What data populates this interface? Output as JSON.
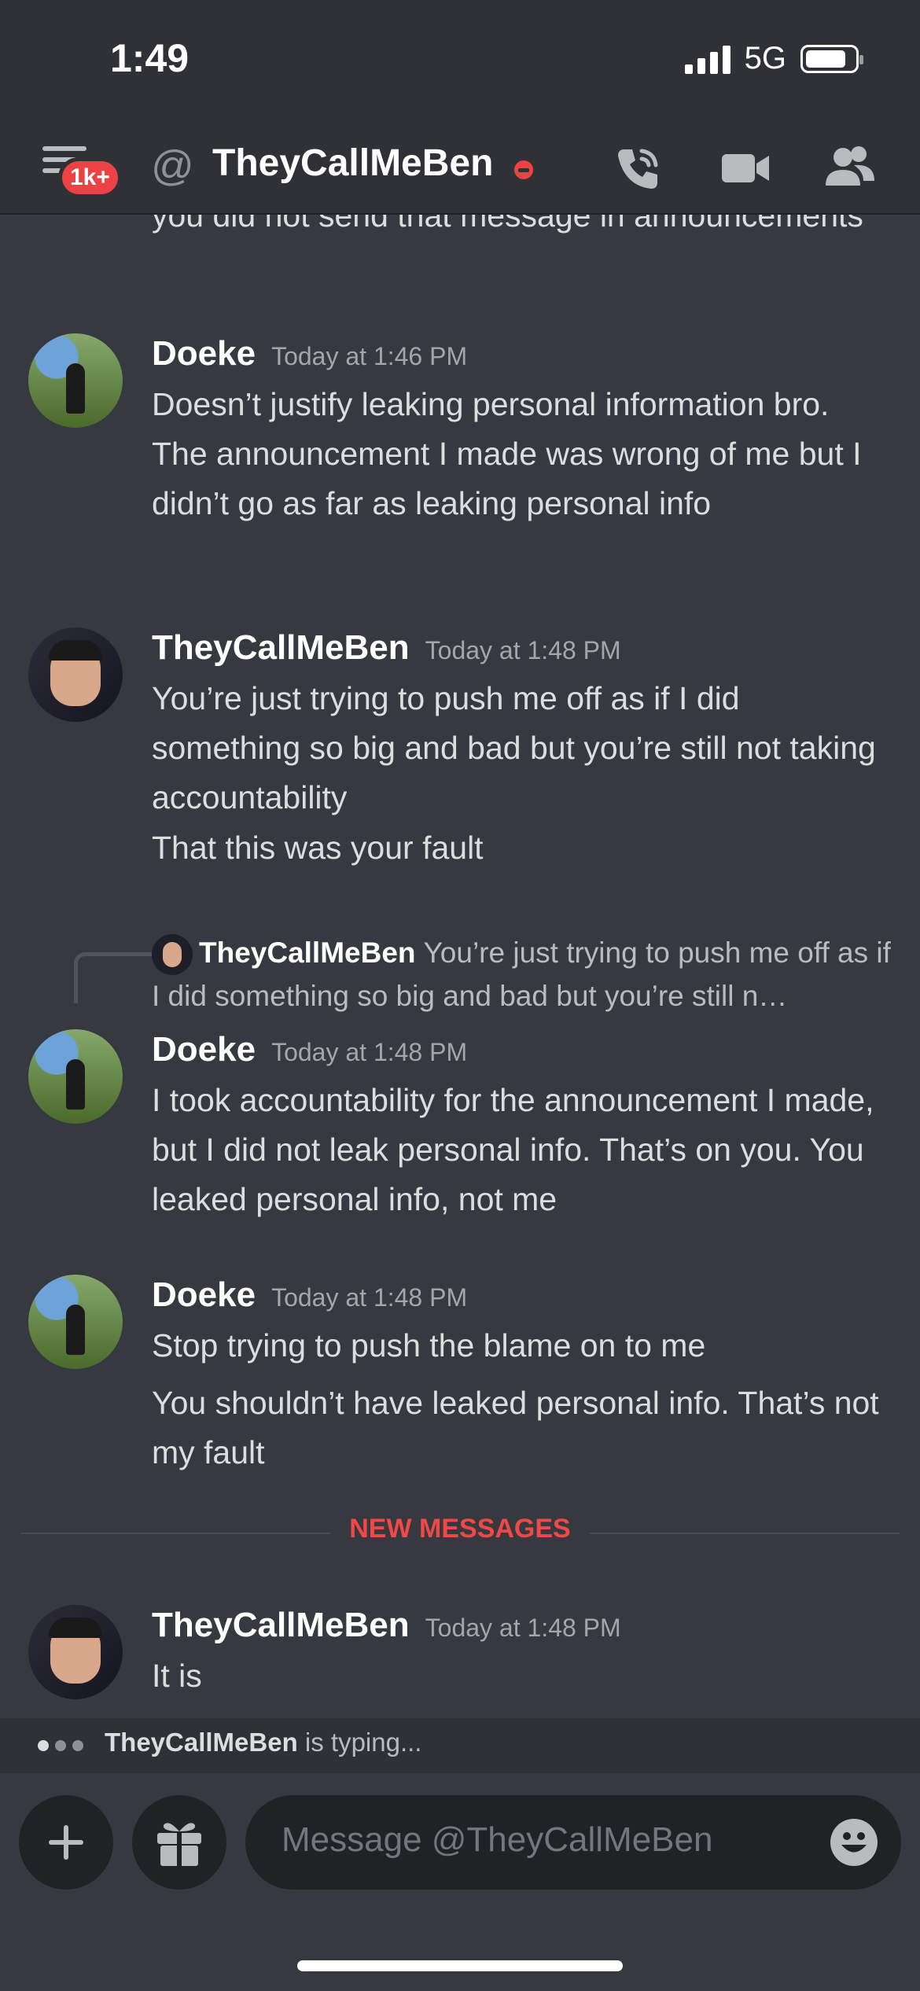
{
  "status_bar": {
    "time": "1:49",
    "network": "5G"
  },
  "header": {
    "notification_badge": "1k+",
    "at_symbol": "@",
    "channel_name": "TheyCallMeBen"
  },
  "chat": {
    "partial_message": {
      "lines": "you did not send that message in announcements"
    },
    "messages": [
      {
        "author": "Doeke",
        "timestamp": "Today at 1:46 PM",
        "text": "Doesn’t justify leaking personal information bro. The announcement I made was wrong of me but I didn’t go as far as leaking personal info"
      },
      {
        "author": "TheyCallMeBen",
        "timestamp": "Today at 1:48 PM",
        "text": "You’re just trying to push me off as if I did something so big and bad but you’re still not taking accountability",
        "followup": "That this was your fault"
      },
      {
        "reply_to": {
          "author": "TheyCallMeBen",
          "text": "You’re just trying to push me off as if I did something so big and bad but you’re still n…"
        },
        "author": "Doeke",
        "timestamp": "Today at 1:48 PM",
        "text": "I took accountability for the announcement I made, but I did not leak personal info. That’s on you. You leaked personal info, not me"
      },
      {
        "author": "Doeke",
        "timestamp": "Today at 1:48 PM",
        "text": "Stop trying to push the blame on to me",
        "followup": "You shouldn’t have leaked personal info. That’s not my fault"
      },
      {
        "author": "TheyCallMeBen",
        "timestamp": "Today at 1:48 PM",
        "text": "It is"
      }
    ],
    "new_messages_label": "NEW MESSAGES"
  },
  "typing": {
    "user": "TheyCallMeBen",
    "suffix": "is typing..."
  },
  "composer": {
    "placeholder": "Message @TheyCallMeBen",
    "plus_label": "+"
  }
}
